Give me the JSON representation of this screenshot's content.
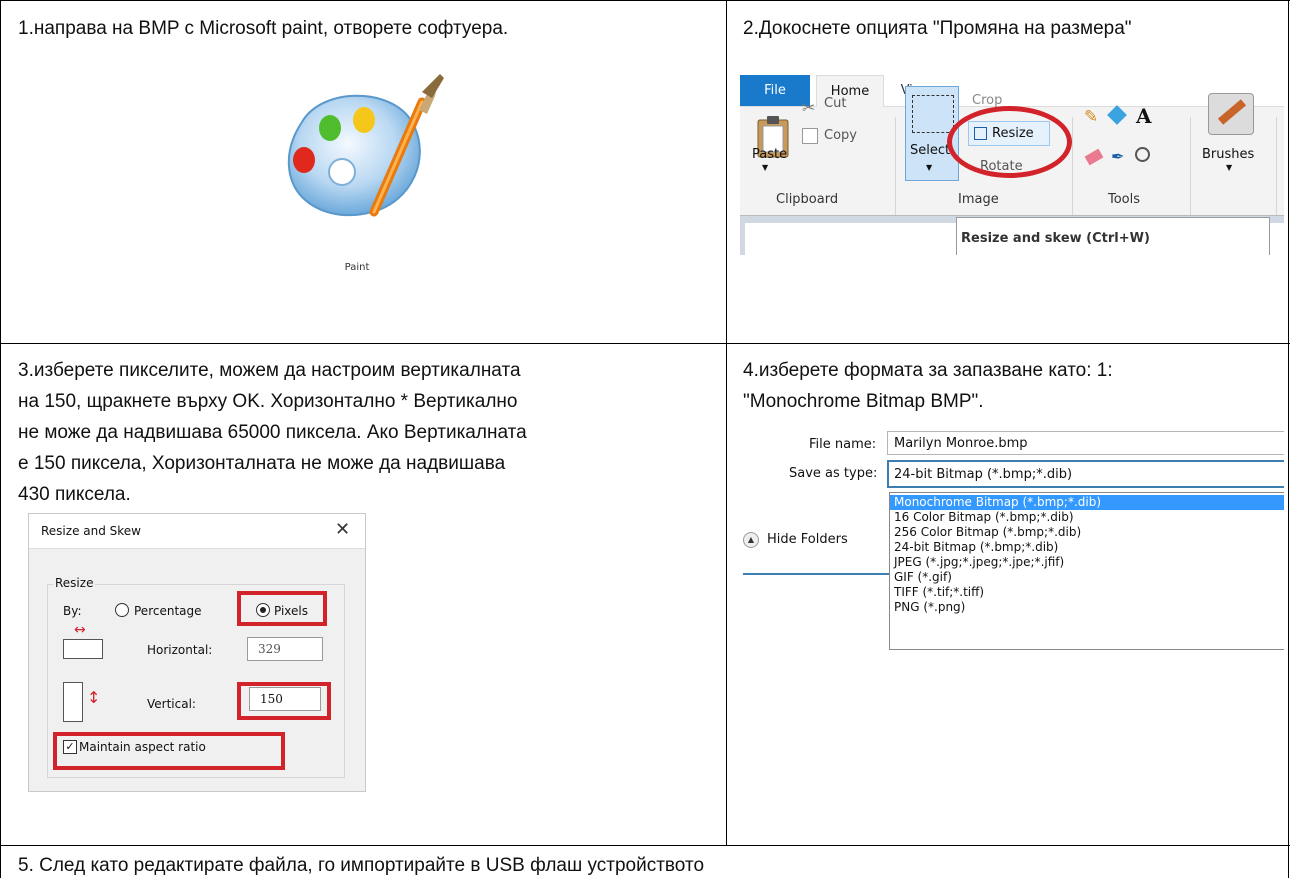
{
  "cells": {
    "step1": "1.направа на BMP с Microsoft paint, отворете софтуера.",
    "step2": "2.Докоснете опцията \"Промяна на размера\"",
    "step3_lines": [
      "3.изберете пикселите, можем да настроим вертикалната",
      "на 150, щракнете върху OK. Хоризонтално * Вертикално",
      "не може да надвишава 65000 пиксела. Ако Вертикалната",
      "е 150 пиксела, Хоризонталната не може да надвишава",
      "430 пиксела."
    ],
    "step4_lines": [
      "4.изберете формата за запазване като: 1:",
      "\"Monochrome Bitmap BMP\"."
    ],
    "step5": "5. След като редактирате файла, го импортирайте в USB флаш устройството"
  },
  "paint_logo": {
    "caption": "Paint"
  },
  "ribbon": {
    "tabs": [
      "File",
      "Home",
      "View"
    ],
    "clipboard": {
      "paste": "Paste",
      "cut": "Cut",
      "copy": "Copy",
      "group": "Clipboard"
    },
    "image": {
      "select": "Select",
      "crop": "Crop",
      "resize": "Resize",
      "rotate": "Rotate",
      "group": "Image"
    },
    "tools": {
      "group": "Tools"
    },
    "brushes": "Brushes",
    "tooltip": "Resize and skew (Ctrl+W)",
    "colors": {
      "file_tab": "#1979ca",
      "highlight": "#d2232a"
    }
  },
  "resize_dialog": {
    "title": "Resize and Skew",
    "group": "Resize",
    "by_label": "By:",
    "percentage": "Percentage",
    "pixels": "Pixels",
    "horizontal_label": "Horizontal:",
    "horizontal_value": "329",
    "vertical_label": "Vertical:",
    "vertical_value": "150",
    "maintain": "Maintain aspect ratio"
  },
  "save_dialog": {
    "file_name_label": "File name:",
    "file_name_value": "Marilyn Monroe.bmp",
    "save_as_label": "Save as type:",
    "save_as_value": "24-bit Bitmap (*.bmp;*.dib)",
    "hide_folders": "Hide Folders",
    "options": [
      "Monochrome Bitmap (*.bmp;*.dib)",
      "16 Color Bitmap (*.bmp;*.dib)",
      "256 Color Bitmap (*.bmp;*.dib)",
      "24-bit Bitmap (*.bmp;*.dib)",
      "JPEG (*.jpg;*.jpeg;*.jpe;*.jfif)",
      "GIF (*.gif)",
      "TIFF (*.tif;*.tiff)",
      "PNG (*.png)"
    ],
    "selected_index": 0
  }
}
